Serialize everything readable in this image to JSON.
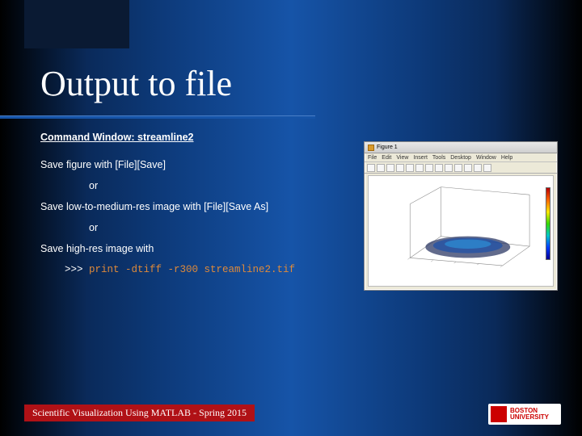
{
  "slide": {
    "title": "Output to file",
    "command_label": "Command Window: streamline2",
    "line1": "Save figure with [File][Save]",
    "or1": "or",
    "line2": "Save low-to-medium-res image with [File][Save As]",
    "or2": "or",
    "line3": "Save high-res image with",
    "prompt_prefix": ">>> ",
    "prompt_cmd": "print -dtiff -r300 streamline2.tif"
  },
  "matlab_window": {
    "title": "Figure 1",
    "menu": [
      "File",
      "Edit",
      "View",
      "Insert",
      "Tools",
      "Desktop",
      "Window",
      "Help"
    ]
  },
  "footer": "Scientific Visualization Using MATLAB - Spring 2015",
  "logo": {
    "line1": "BOSTON",
    "line2": "UNIVERSITY"
  }
}
